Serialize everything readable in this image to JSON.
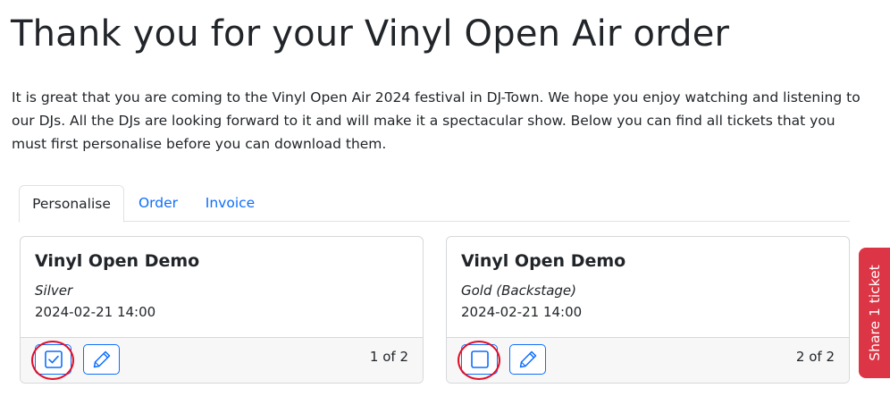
{
  "page": {
    "title": "Thank you for your Vinyl Open Air order",
    "intro": "It is great that you are coming to the Vinyl Open Air 2024 festival in DJ-Town. We hope you enjoy watching and listening to our DJs. All the DJs are looking forward to it and will make it a spectacular show. Below you can find all tickets that you must first personalise before you can download them."
  },
  "tabs": [
    {
      "label": "Personalise",
      "active": true
    },
    {
      "label": "Order",
      "active": false
    },
    {
      "label": "Invoice",
      "active": false
    }
  ],
  "tickets": [
    {
      "event": "Vinyl Open Demo",
      "ticket_type": "Silver",
      "datetime": "2024-02-21 14:00",
      "selected": true,
      "position": "1 of 2"
    },
    {
      "event": "Vinyl Open Demo",
      "ticket_type": "Gold (Backstage)",
      "datetime": "2024-02-21 14:00",
      "selected": false,
      "position": "2 of 2"
    }
  ],
  "share_tab": {
    "label": "Share 1 ticket"
  },
  "colors": {
    "primary": "#0d6efd",
    "danger": "#dc3545",
    "highlight": "#e0102a"
  }
}
